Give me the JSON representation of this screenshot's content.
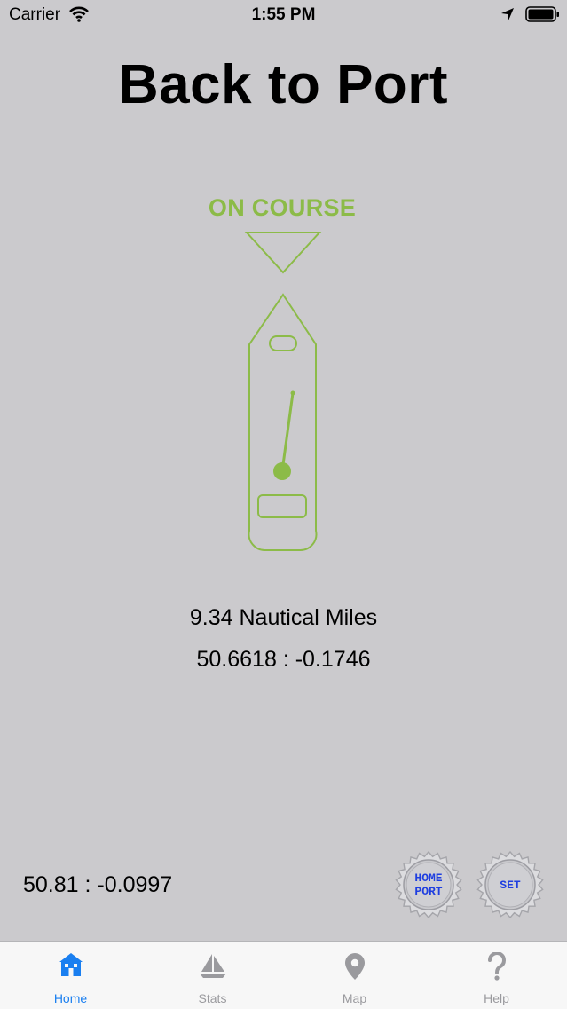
{
  "status_bar": {
    "carrier": "Carrier",
    "time": "1:55 PM"
  },
  "title": "Back to Port",
  "course_status": "ON COURSE",
  "distance": "9.34 Nautical Miles",
  "target_coords": "50.6618 : -0.1746",
  "current_coords": "50.81 : -0.0997",
  "buttons": {
    "home_port_line1": "HOME",
    "home_port_line2": "PORT",
    "set": "SET"
  },
  "tabs": [
    {
      "label": "Home",
      "icon": "house-icon",
      "active": true
    },
    {
      "label": "Stats",
      "icon": "sailboat-icon",
      "active": false
    },
    {
      "label": "Map",
      "icon": "map-pin-icon",
      "active": false
    },
    {
      "label": "Help",
      "icon": "question-icon",
      "active": false
    }
  ],
  "colors": {
    "accent": "#8cbb48",
    "tab_active": "#1a7ff0",
    "button_text": "#1f3fe0",
    "background": "#cbcacd"
  }
}
